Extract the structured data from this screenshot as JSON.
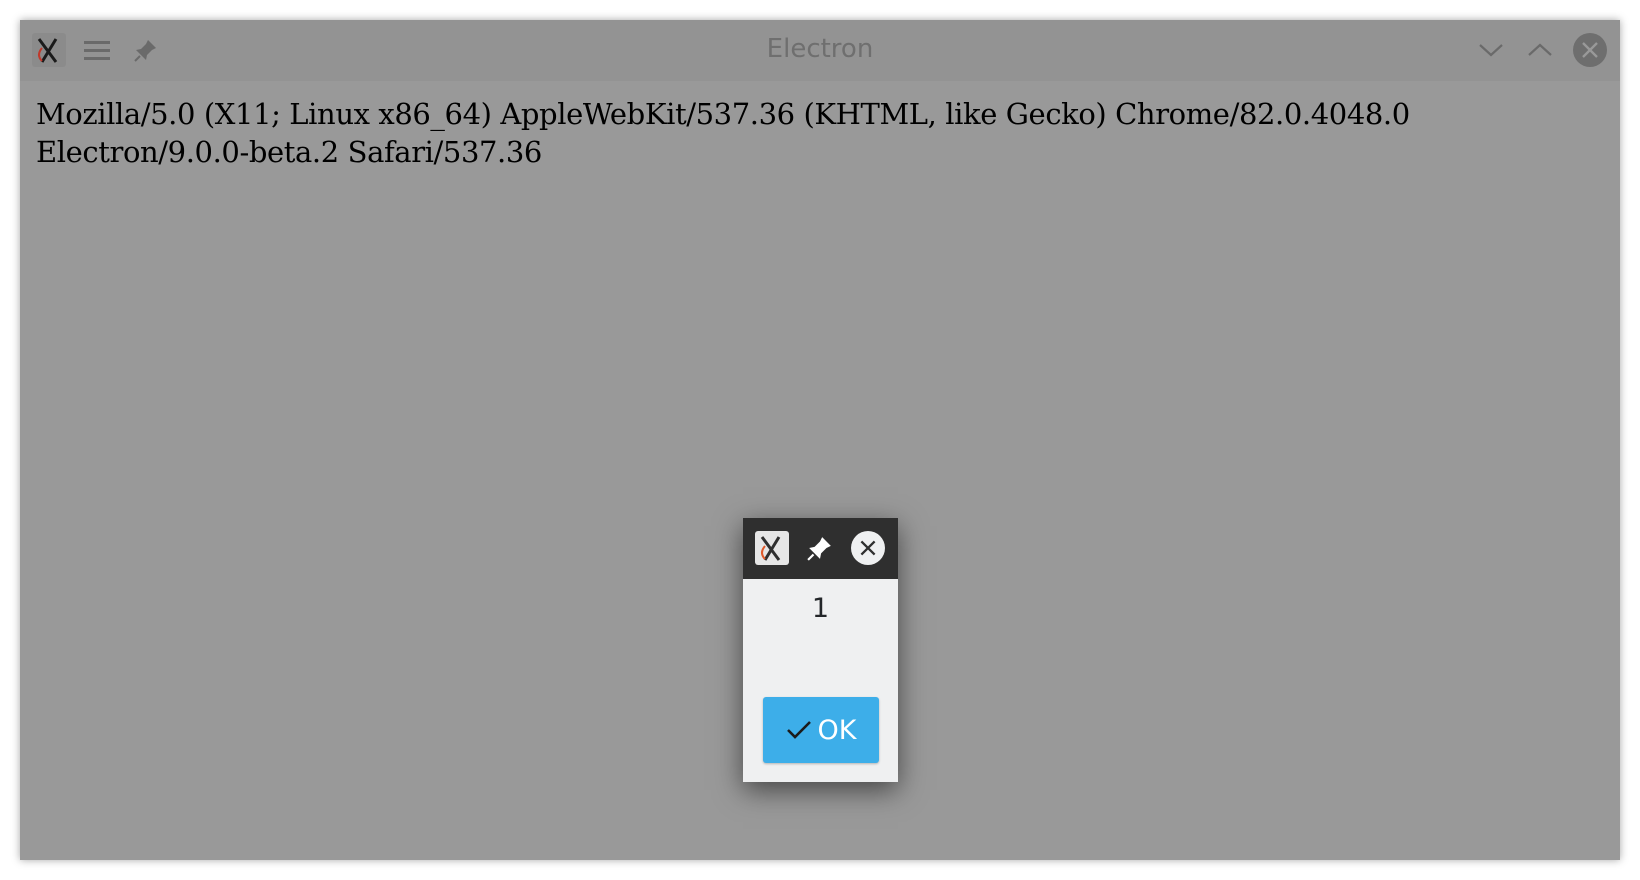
{
  "window": {
    "title": "Electron",
    "content_text": "Mozilla/5.0 (X11; Linux x86_64) AppleWebKit/537.36 (KHTML, like Gecko) Chrome/82.0.4048.0 Electron/9.0.0-beta.2 Safari/537.36",
    "icons": {
      "app": "xwayland-app-icon",
      "menu": "hamburger-menu-icon",
      "pin": "pin-icon",
      "minimize": "chevron-down-icon",
      "maximize": "chevron-up-icon",
      "close": "close-icon"
    },
    "colors": {
      "background": "#999999",
      "titlebar": "#939393",
      "title_text": "#6f6f6f"
    }
  },
  "dialog": {
    "message": "1",
    "ok_label": "OK",
    "icons": {
      "app": "xwayland-app-icon",
      "pin": "pin-icon",
      "close": "close-icon",
      "ok": "checkmark-icon"
    },
    "colors": {
      "titlebar": "#2f2f2f",
      "body": "#eff0f1",
      "button": "#3daee9"
    }
  }
}
